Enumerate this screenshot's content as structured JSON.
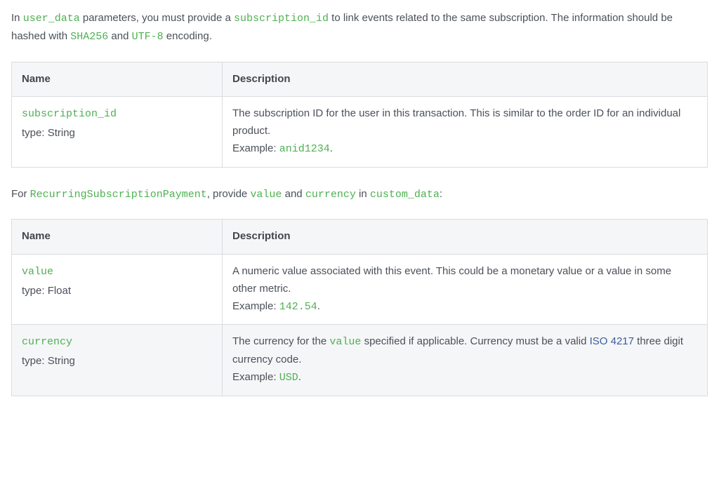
{
  "intro1": {
    "pre": "In ",
    "user_data": "user_data",
    "mid1": " parameters, you must provide a ",
    "sub_id": "subscription_id",
    "mid2": " to link events related to the same subscription. The information should be hashed with ",
    "sha": "SHA256",
    "and": " and ",
    "utf": "UTF-8",
    "post": " encoding."
  },
  "headers": {
    "name": "Name",
    "description": "Description"
  },
  "type_prefix": "type: ",
  "example_prefix": "Example: ",
  "table1": {
    "row1": {
      "name_code": "subscription_id",
      "type": "String",
      "desc": "The subscription ID for the user in this transaction. This is similar to the order ID for an individual product.",
      "example_code": "anid1234"
    }
  },
  "intro2": {
    "pre": "For ",
    "rsp": "RecurringSubscriptionPayment",
    "mid1": ", provide ",
    "value": "value",
    "and": " and ",
    "currency": "currency",
    "mid2": " in ",
    "custom_data": "custom_data",
    "post": ":"
  },
  "table2": {
    "row1": {
      "name_code": "value",
      "type": "Float",
      "desc": "A numeric value associated with this event. This could be a monetary value or a value in some other metric.",
      "example_code": "142.54"
    },
    "row2": {
      "name_code": "currency",
      "type": "String",
      "desc_pre": "The currency for the ",
      "value_code": "value",
      "desc_mid": " specified if applicable. Currency must be a valid ",
      "iso_link": "ISO 4217",
      "desc_post": " three digit currency code.",
      "example_code": "USD"
    }
  }
}
